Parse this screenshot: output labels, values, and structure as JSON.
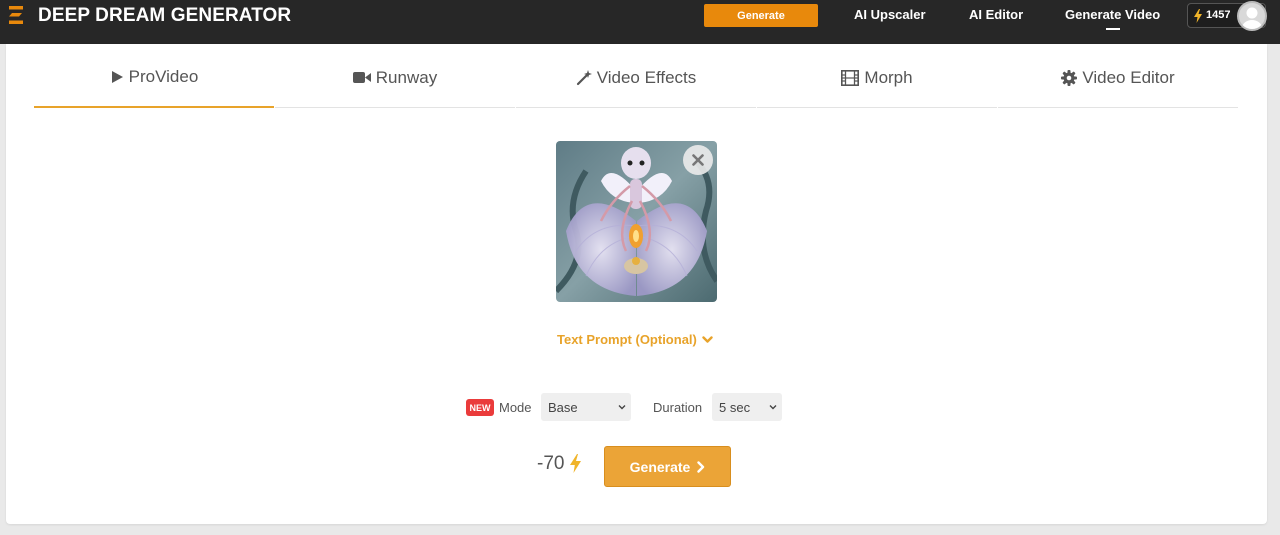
{
  "header": {
    "brand": "DEEP DREAM GENERATOR",
    "generate_label": "Generate",
    "nav": [
      "AI Upscaler",
      "AI Editor",
      "Generate Video"
    ],
    "credits": "1457",
    "accent_color": "#e8890c"
  },
  "tabs": [
    {
      "label": "ProVideo",
      "icon": "play-icon",
      "active": true
    },
    {
      "label": "Runway",
      "icon": "video-camera-icon",
      "active": false
    },
    {
      "label": "Video Effects",
      "icon": "magic-wand-icon",
      "active": false
    },
    {
      "label": "Morph",
      "icon": "film-icon",
      "active": false
    },
    {
      "label": "Video Editor",
      "icon": "gear-icon",
      "active": false
    }
  ],
  "image": {
    "alt": "Uploaded source image"
  },
  "prompt": {
    "toggle_label": "Text Prompt (Optional)"
  },
  "options": {
    "new_badge": "NEW",
    "mode_label": "Mode",
    "mode_value": "Base",
    "duration_label": "Duration",
    "duration_value": "5 sec"
  },
  "action": {
    "cost": "-70",
    "generate_label": "Generate"
  }
}
